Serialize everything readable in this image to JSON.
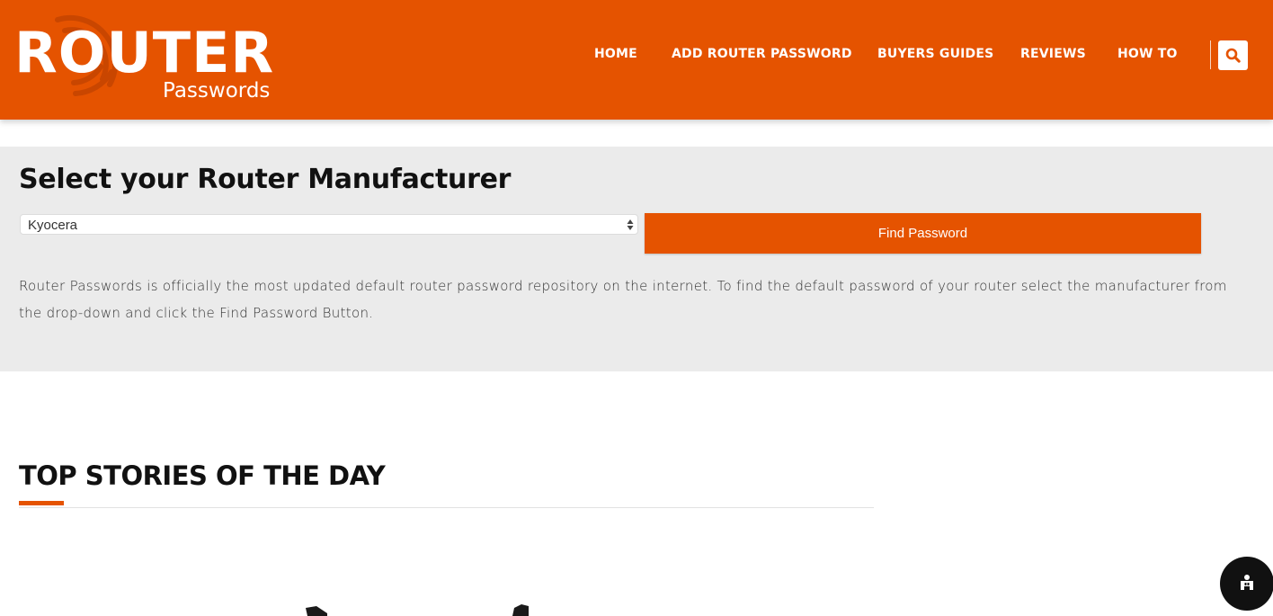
{
  "brand": {
    "logo_main": "ROUTER",
    "logo_sub": "Passwords",
    "primary_color": "#e55300"
  },
  "nav": {
    "items": [
      {
        "label": "HOME"
      },
      {
        "label": "ADD ROUTER PASSWORD"
      },
      {
        "label": "BUYERS GUIDES"
      },
      {
        "label": "REVIEWS"
      },
      {
        "label": "HOW TO"
      }
    ],
    "search_icon": "search-icon"
  },
  "selector": {
    "title": "Select your Router Manufacturer",
    "selected_value": "Kyocera",
    "button_label": "Find Password",
    "description": "Router Passwords is officially the most updated default router password repository on the internet. To find the default password of your router select the manufacturer from the drop-down and click the Find Password Button."
  },
  "stories": {
    "title": "TOP STORIES OF THE DAY"
  },
  "help_widget": {
    "icon": "accessibility-icon"
  }
}
